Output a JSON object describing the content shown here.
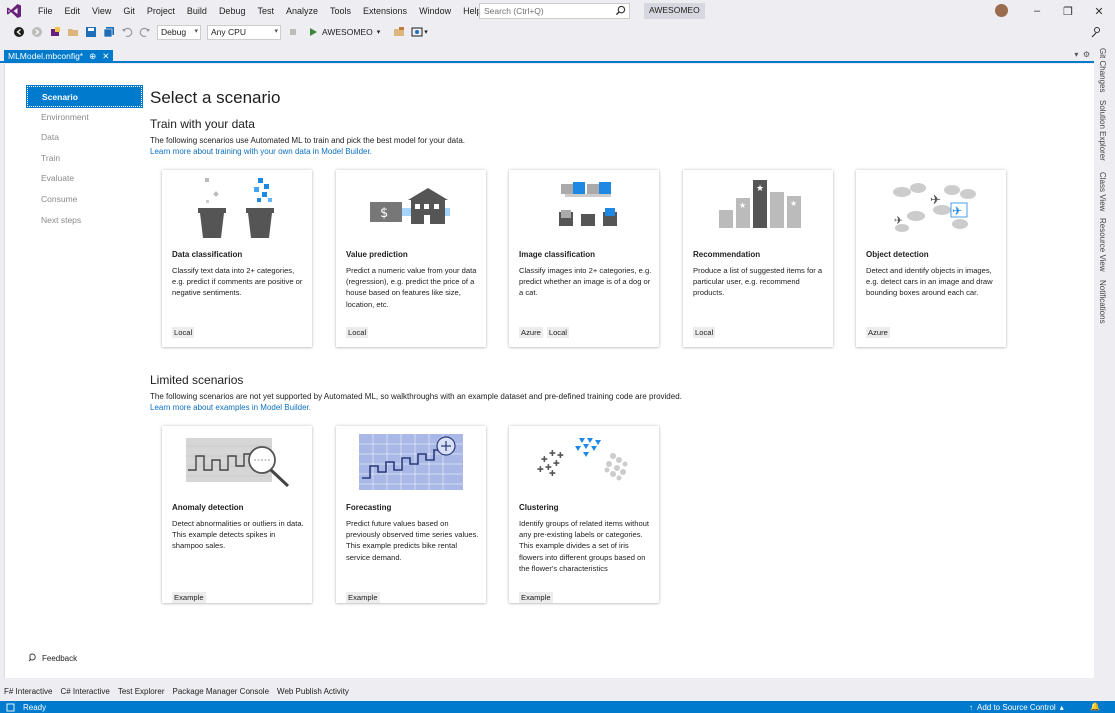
{
  "menu": {
    "items": [
      "File",
      "Edit",
      "View",
      "Git",
      "Project",
      "Build",
      "Debug",
      "Test",
      "Analyze",
      "Tools",
      "Extensions",
      "Window",
      "Help"
    ],
    "search_placeholder": "Search (Ctrl+Q)",
    "solution": "AWESOMEO"
  },
  "toolbar": {
    "configuration": "Debug",
    "platform": "Any CPU",
    "run_label": "AWESOMEO"
  },
  "document_tab": {
    "title": "MLModel.mbconfig*"
  },
  "side_tabs": [
    "Git Changes",
    "Solution Explorer",
    "Class View",
    "Resource View",
    "Notifications"
  ],
  "steps": [
    "Scenario",
    "Environment",
    "Data",
    "Train",
    "Evaluate",
    "Consume",
    "Next steps"
  ],
  "page_title": "Select a scenario",
  "train_section": {
    "heading": "Train with your data",
    "description": "The following scenarios use Automated ML to train and pick the best model for your data.",
    "link": "Learn more about training with your own data in Model Builder."
  },
  "train_cards": [
    {
      "title": "Data classification",
      "text": "Classify text data into 2+ categories, e.g. predict if comments are positive or negative sentiments.",
      "tags": [
        "Local"
      ]
    },
    {
      "title": "Value prediction",
      "text": "Predict a numeric value from your data (regression), e.g. predict the price of a house based on features like size, location, etc.",
      "tags": [
        "Local"
      ]
    },
    {
      "title": "Image classification",
      "text": "Classify images into 2+ categories, e.g. predict whether an image is of a dog or a cat.",
      "tags": [
        "Azure",
        "Local"
      ]
    },
    {
      "title": "Recommendation",
      "text": "Produce a list of suggested items for a particular user, e.g. recommend products.",
      "tags": [
        "Local"
      ]
    },
    {
      "title": "Object detection",
      "text": "Detect and identify objects in images, e.g. detect cars in an image and draw bounding boxes around each car.",
      "tags": [
        "Azure"
      ]
    }
  ],
  "limited_section": {
    "heading": "Limited scenarios",
    "description": "The following scenarios are not yet supported by Automated ML, so walkthroughs with an example dataset and pre-defined training code are provided.",
    "link": "Learn more about examples in Model Builder."
  },
  "limited_cards": [
    {
      "title": "Anomaly detection",
      "text": "Detect abnormalities or outliers in data. This example detects spikes in shampoo sales.",
      "tags": [
        "Example"
      ]
    },
    {
      "title": "Forecasting",
      "text": "Predict future values based on previously observed time series values. This example predicts bike rental service demand.",
      "tags": [
        "Example"
      ]
    },
    {
      "title": "Clustering",
      "text": "Identify groups of related items without any pre-existing labels or categories. This example divides a set of iris flowers into different groups based on the flower's characteristics",
      "tags": [
        "Example"
      ]
    }
  ],
  "feedback": "Feedback",
  "bottom_tabs": [
    "F# Interactive",
    "C# Interactive",
    "Test Explorer",
    "Package Manager Console",
    "Web Publish Activity"
  ],
  "status": {
    "ready": "Ready",
    "source_control": "Add to Source Control"
  },
  "colors": {
    "accent": "#007acc",
    "link": "#0e70c0"
  }
}
